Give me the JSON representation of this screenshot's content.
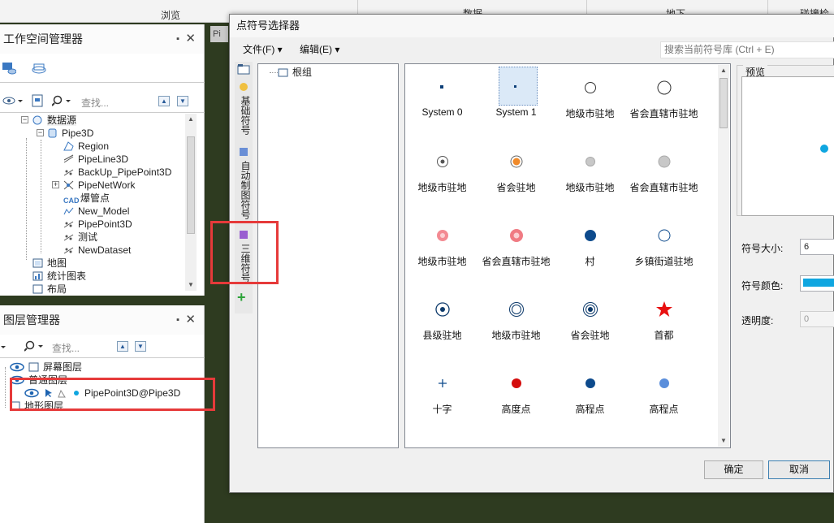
{
  "ribbon": {
    "browse": "浏览",
    "data": "数据",
    "under": "地下",
    "connect": "碰撞检"
  },
  "workspace": {
    "title": "工作空间管理器",
    "find_placeholder": "查找...",
    "items": [
      "数据源",
      "Pipe3D",
      "Region",
      "PipeLine3D",
      "BackUp_PipePoint3D",
      "PipeNetWork",
      "爆管点",
      "New_Model",
      "PipePoint3D",
      "测试",
      "NewDataset",
      "地图",
      "统计图表",
      "布局"
    ]
  },
  "layers": {
    "title": "图层管理器",
    "find_placeholder": "查找...",
    "items": [
      "屏幕图层",
      "普通图层",
      "PipePoint3D@Pipe3D",
      "地形图层"
    ]
  },
  "doc_tab": "Pi",
  "dialog": {
    "title": "点符号选择器",
    "menu_file": "文件(F)",
    "menu_edit": "编辑(E)",
    "search_placeholder": "搜索当前符号库 (Ctrl + E)",
    "vtabs": [
      "基础符号",
      "自动制图符号",
      "三维符号"
    ],
    "root_group": "根组",
    "symbols": [
      "System 0",
      "System 1",
      "地级市驻地",
      "省会直辖市驻地",
      "地级市驻地",
      "省会驻地",
      "地级市驻地",
      "省会直辖市驻地",
      "地级市驻地",
      "省会直辖市驻地",
      "村",
      "乡镇街道驻地",
      "县级驻地",
      "地级市驻地",
      "省会驻地",
      "首都",
      "十字",
      "高度点",
      "高程点",
      "高程点"
    ],
    "preview_label": "预览",
    "size_label": "符号大小:",
    "size_value": "6",
    "color_label": "符号颜色:",
    "opacity_label": "透明度:",
    "opacity_value": "0",
    "ok": "确定",
    "cancel": "取消"
  },
  "colors": {
    "accent": "#0fa6e0",
    "highlight": "#e63a3a",
    "navy": "#0d4a8c"
  }
}
